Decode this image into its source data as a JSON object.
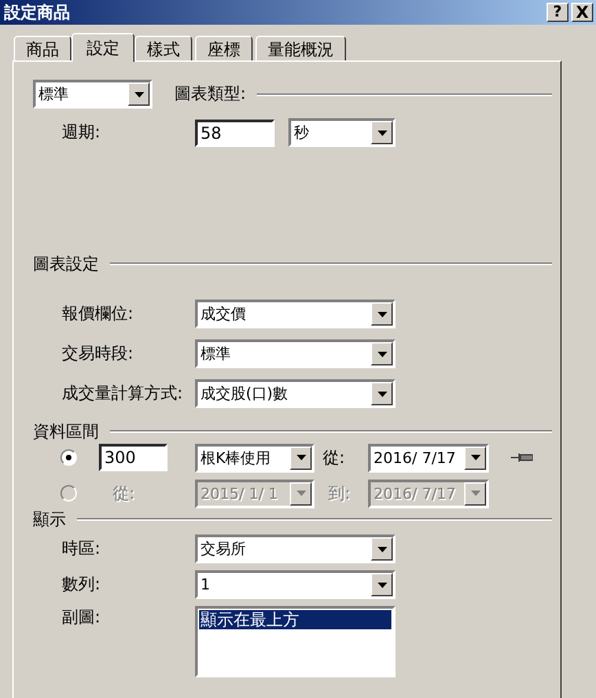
{
  "window": {
    "title": "設定商品",
    "buttons": [
      {
        "kind": "help",
        "text": "?"
      },
      {
        "kind": "close",
        "text": "X"
      }
    ]
  },
  "tabs": [
    {
      "label": "商品",
      "selected": false
    },
    {
      "label": "設定",
      "selected": true
    },
    {
      "label": "樣式",
      "selected": false
    },
    {
      "label": "座標",
      "selected": false
    },
    {
      "label": "量能概況",
      "selected": false
    }
  ],
  "chart_type": {
    "value": "標準",
    "label": "圖表類型:"
  },
  "period": {
    "label": "週期:",
    "value": "58",
    "unit": "秒"
  },
  "chart_settings": {
    "title": "圖表設定",
    "rows": [
      {
        "label": "報價欄位:",
        "value": "成交價"
      },
      {
        "label": "交易時段:",
        "value": "標準"
      },
      {
        "label": "成交量計算方式:",
        "value": "成交股(口)數"
      }
    ]
  },
  "data_range": {
    "title": "資料區間",
    "options": [
      {
        "kind": "count",
        "selected": true,
        "disabled": false,
        "count": "300",
        "mode": "根K棒使用",
        "from_label": "從:",
        "from": "2016/ 7/17"
      },
      {
        "kind": "range",
        "selected": false,
        "disabled": true,
        "from_label": "從:",
        "from": "2015/ 1/ 1",
        "to_label": "到:",
        "to": "2016/ 7/17"
      }
    ]
  },
  "display": {
    "title": "顯示",
    "rows": [
      {
        "kind": "dropdown",
        "label": "時區:",
        "value": "交易所"
      },
      {
        "kind": "dropdown",
        "label": "數列:",
        "value": "1"
      },
      {
        "kind": "list",
        "label": "副圖:",
        "items": [
          {
            "text": "顯示在最上方",
            "selected": true
          }
        ]
      }
    ]
  }
}
